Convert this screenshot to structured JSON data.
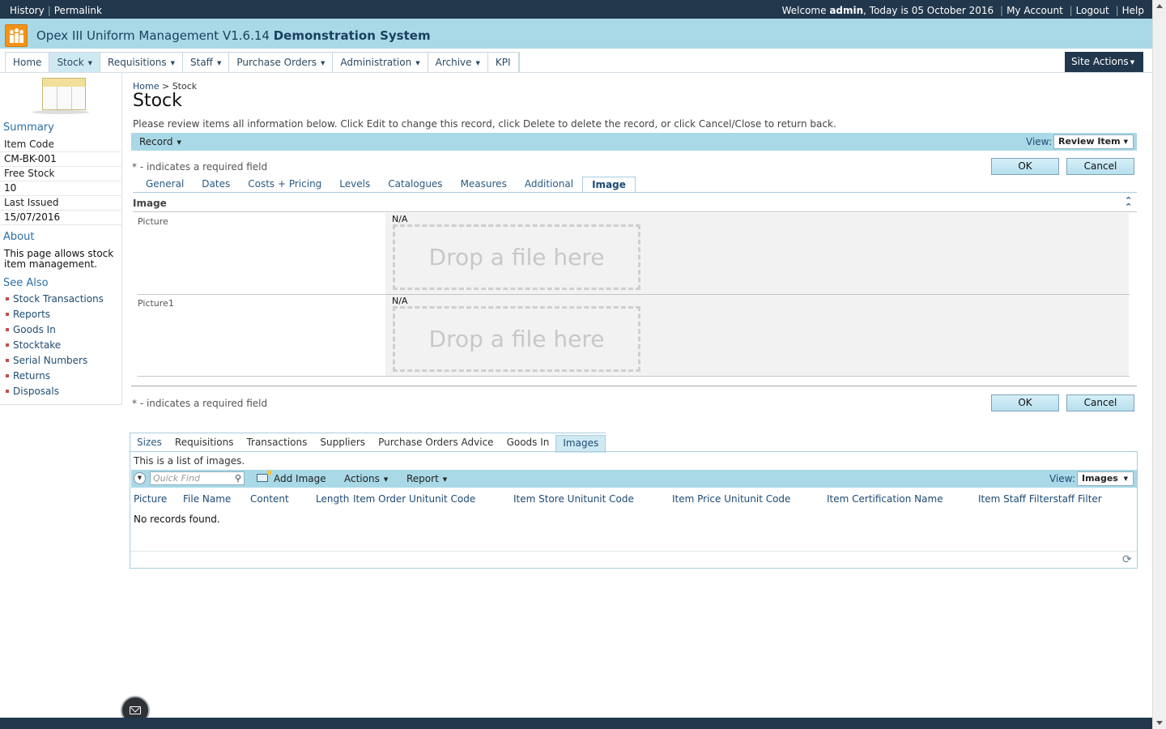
{
  "topbar": {
    "history": "History",
    "permalink": "Permalink",
    "welcome_prefix": "Welcome",
    "user": "admin",
    "today": ", Today is 05 October 2016",
    "my_account": "My Account",
    "logout": "Logout",
    "help": "Help"
  },
  "app": {
    "title": "Opex III Uniform Management V1.6.14",
    "system": "Demonstration System",
    "icon": "people-logo-icon"
  },
  "nav": {
    "items": [
      {
        "label": "Home"
      },
      {
        "label": "Stock"
      },
      {
        "label": "Requisitions"
      },
      {
        "label": "Staff"
      },
      {
        "label": "Purchase Orders"
      },
      {
        "label": "Administration"
      },
      {
        "label": "Archive"
      },
      {
        "label": "KPI"
      }
    ],
    "site_actions": "Site Actions"
  },
  "sidebar": {
    "summary_title": "Summary",
    "item_code_label": "Item Code",
    "item_code": "CM-BK-001",
    "free_stock_label": "Free Stock",
    "free_stock": "10",
    "last_issued_label": "Last Issued",
    "last_issued": "15/07/2016",
    "about_title": "About",
    "about_text": "This page allows stock item management.",
    "see_also_title": "See Also",
    "see_also": [
      "Stock Transactions",
      "Reports",
      "Goods In",
      "Stocktake",
      "Serial Numbers",
      "Returns",
      "Disposals"
    ]
  },
  "main": {
    "breadcrumb_home": "Home",
    "breadcrumb_sep": ">",
    "breadcrumb_current": "Stock",
    "title": "Stock",
    "instructions": "Please review items all information below. Click Edit to change this record, click Delete to delete the record, or click Cancel/Close to return back.",
    "record_menu": "Record",
    "view_label": "View:",
    "view_value": "Review Item",
    "required_note": "* - indicates a required field",
    "ok": "OK",
    "cancel": "Cancel",
    "tabs": [
      "General",
      "Dates",
      "Costs + Pricing",
      "Levels",
      "Catalogues",
      "Measures",
      "Additional",
      "Image"
    ],
    "section_title": "Image",
    "fields": [
      {
        "label": "Picture",
        "value": "N/A",
        "drop": "Drop a file here"
      },
      {
        "label": "Picture1",
        "value": "N/A",
        "drop": "Drop a file here"
      }
    ]
  },
  "detail": {
    "tabs": [
      "Sizes",
      "Requisitions",
      "Transactions",
      "Suppliers",
      "Purchase Orders Advice",
      "Goods In",
      "Images"
    ],
    "intro": "This is a list of images.",
    "quick_find_placeholder": "Quick Find",
    "add_image": "Add Image",
    "actions": "Actions",
    "report": "Report",
    "view_label": "View:",
    "view_value": "Images",
    "columns": [
      "Picture",
      "File Name",
      "Content",
      "Length",
      "Item Order Unitunit Code",
      "Item Store Unitunit Code",
      "Item Price Unitunit Code",
      "Item Certification Name",
      "Item Staff Filterstaff Filter"
    ],
    "empty": "No records found."
  }
}
